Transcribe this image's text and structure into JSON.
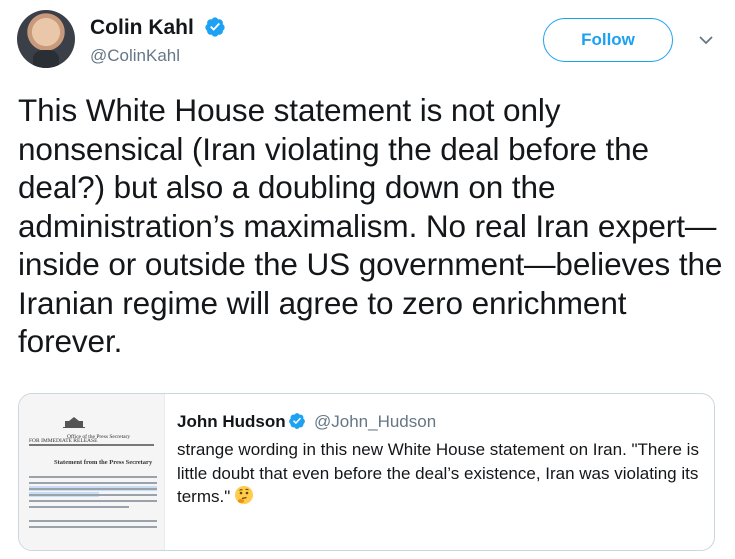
{
  "author": {
    "name": "Colin Kahl",
    "handle": "@ColinKahl",
    "follow_label": "Follow"
  },
  "tweet": {
    "text": "This White House statement is not only nonsensical (Iran violating the deal before the deal?) but also a doubling down on the administration’s maximalism. No real Iran expert—inside or outside the US government—believes the Iranian regime will agree to zero enrichment forever."
  },
  "quoted_tweet": {
    "name": "John Hudson",
    "handle": "@John_Hudson",
    "text": "strange wording in this new White House statement on Iran. \"There is little doubt that even before the deal’s existence, Iran was violating its terms.\"",
    "emoji": "thinking-face-icon",
    "image": {
      "office": "Office of the Press Secretary",
      "release": "FOR IMMEDIATE RELEASE",
      "heading": "Statement from the Press Secretary"
    }
  },
  "colors": {
    "accent": "#1da1f2",
    "secondary_text": "#657786",
    "border": "#ccd6dd"
  }
}
